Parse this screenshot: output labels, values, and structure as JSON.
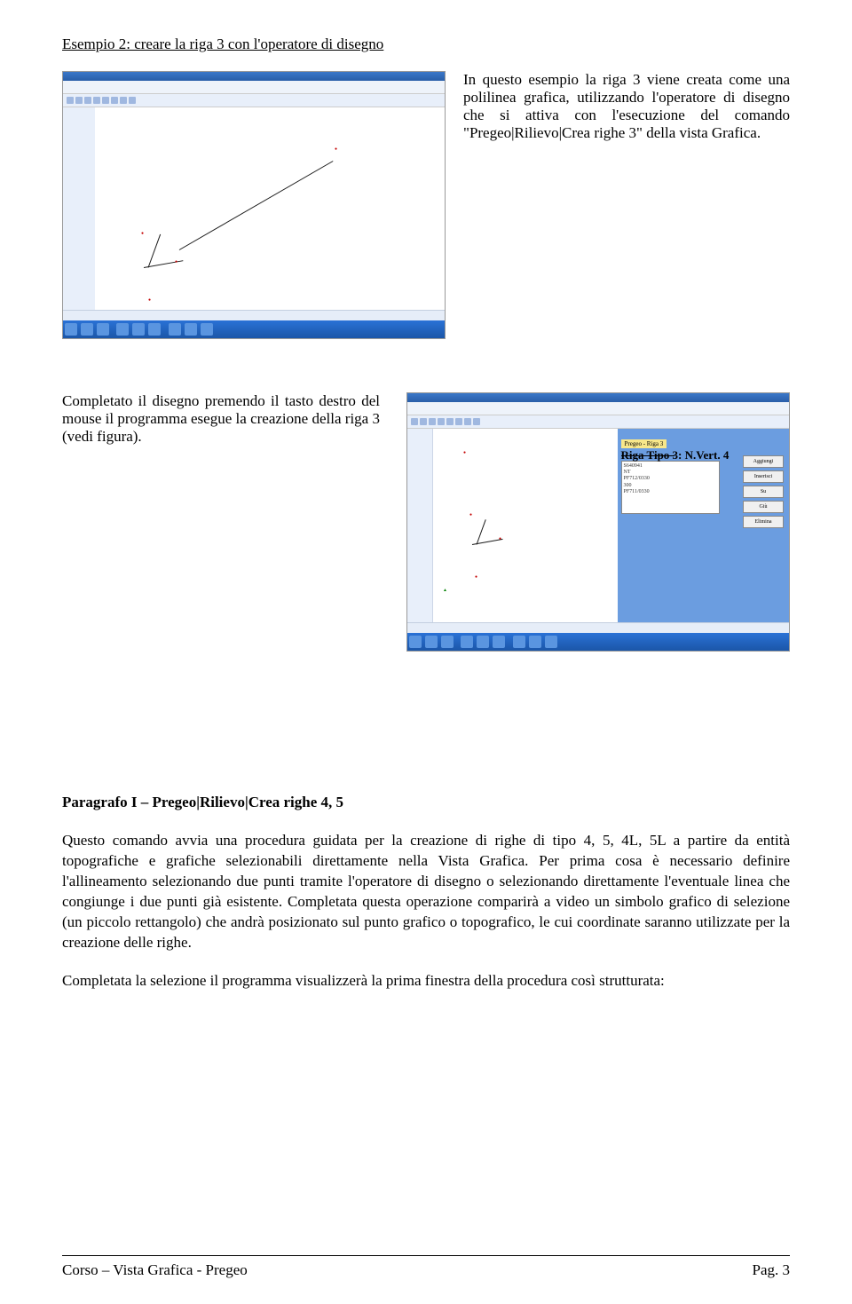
{
  "example": {
    "title": "Esempio 2: creare la riga 3 con l'operatore di disegno",
    "para1": "In questo esempio la riga 3 viene creata come una polilinea grafica, utilizzando l'operatore di disegno che si attiva con l'esecuzione del comando \"Pregeo|Rilievo|Crea righe 3\" della vista Grafica.",
    "para2": "Completato il disegno premendo il tasto destro del mouse il programma esegue la creazione della riga 3 (vedi figura)."
  },
  "screenshot2": {
    "tab_label": "Pregeo - Riga 3",
    "callout_label": "Riga Tipo 3: N.Vert. 4",
    "list_items": [
      "S640941",
      "NT",
      "PF712/0330",
      "300",
      "PF711/0330"
    ],
    "buttons": [
      "Aggiungi",
      "Inserisci",
      "Su",
      "Giù",
      "Elimina"
    ]
  },
  "section": {
    "heading": "Paragrafo I – Pregeo|Rilievo|Crea righe 4, 5",
    "p1": "Questo comando avvia una procedura guidata per la creazione di righe di tipo 4, 5, 4L, 5L a partire da entità topografiche e grafiche selezionabili direttamente nella Vista Grafica.",
    "p2": "Per prima cosa è necessario definire l'allineamento selezionando due punti tramite l'operatore di disegno o selezionando direttamente l'eventuale linea che congiunge i due punti già esistente.",
    "p3": "Completata questa operazione comparirà a video un simbolo grafico di selezione (un piccolo rettangolo) che andrà posizionato sul punto grafico o topografico, le cui coordinate saranno utilizzate per la creazione delle righe.",
    "p4": "Completata la selezione il programma visualizzerà la prima finestra della procedura così strutturata:"
  },
  "footer": {
    "left": "Corso – Vista Grafica - Pregeo",
    "right": "Pag. 3"
  }
}
